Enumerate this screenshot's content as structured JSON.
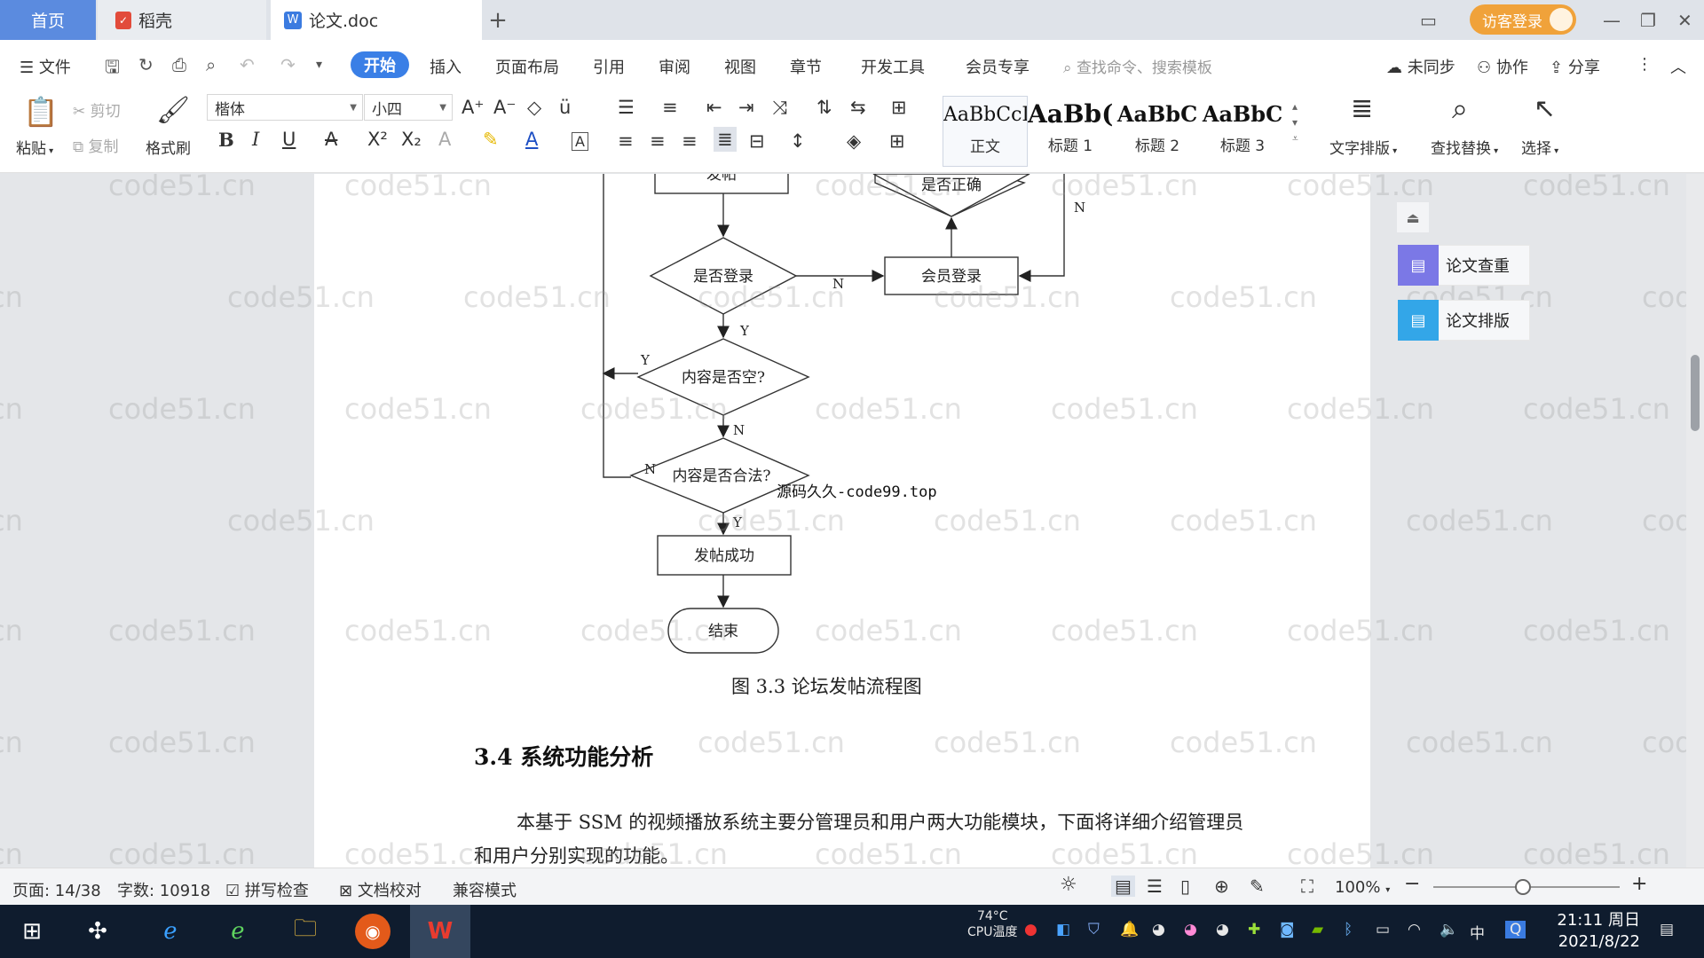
{
  "tabs": {
    "home": "首页",
    "daoke": "稻壳",
    "doc": "论文.doc",
    "add": "+",
    "close": "×"
  },
  "window": {
    "visitor_login": "访客登录",
    "minimize": "—",
    "restore": "❐",
    "close": "✕"
  },
  "menu": {
    "file": "文件",
    "items": [
      "开始",
      "插入",
      "页面布局",
      "引用",
      "审阅",
      "视图",
      "章节",
      "开发工具",
      "会员专享"
    ],
    "search_placeholder": "查找命令、搜索模板",
    "sync": "未同步",
    "collab": "协作",
    "share": "分享"
  },
  "ribbon": {
    "paste": "粘贴",
    "cut": "剪切",
    "copy": "复制",
    "format_painter": "格式刷",
    "font_name": "楷体",
    "font_size": "小四",
    "styles": [
      {
        "sample": "AaBbCcI",
        "name": "正文"
      },
      {
        "sample": "AaBb(",
        "name": "标题 1"
      },
      {
        "sample": "AaBbC",
        "name": "标题 2"
      },
      {
        "sample": "AaBbC",
        "name": "标题 3"
      }
    ],
    "text_layout": "文字排版",
    "find_replace": "查找替换",
    "select": "选择"
  },
  "document": {
    "flowchart": {
      "node_top_left": "发帖",
      "node_top_right": "是否正确",
      "decision_login": "是否登录",
      "member_login": "会员登录",
      "decision_empty": "内容是否空?",
      "decision_legal": "内容是否合法?",
      "post_success": "发帖成功",
      "end": "结束",
      "label_n": "N",
      "label_y": "Y"
    },
    "source_note": "源码久久-code99.top",
    "caption": "图 3.3    论坛发帖流程图",
    "heading": "3.4 系统功能分析",
    "paragraph": "本基于 SSM 的视频播放系统主要分管理员和用户两大功能模块，下面将详细介绍管理员和用户分别实现的功能。",
    "watermark": "code51.cn"
  },
  "side_panel": {
    "check": "论文查重",
    "layout": "论文排版"
  },
  "status": {
    "page": "页面: 14/38",
    "words": "字数: 10918",
    "spell": "拼写检查",
    "proof": "文档校对",
    "compat": "兼容模式",
    "zoom": "100%",
    "zoom_level": 0.5
  },
  "taskbar": {
    "cpu_temp": "74°C",
    "cpu_label": "CPU温度",
    "ime": "中",
    "time": "21:11 周日",
    "date": "2021/8/22"
  }
}
